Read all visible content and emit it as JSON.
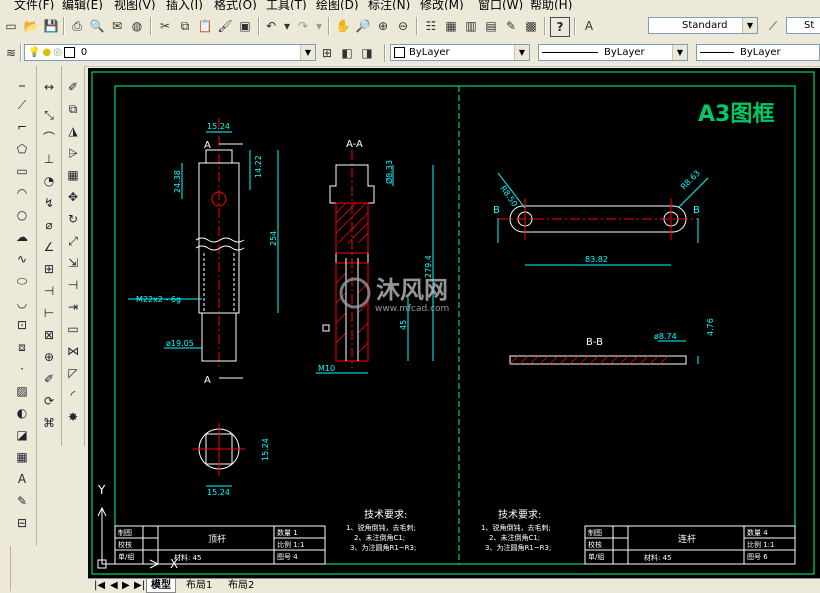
{
  "menu": [
    "文件(F)",
    "编辑(E)",
    "视图(V)",
    "插入(I)",
    "格式(O)",
    "工具(T)",
    "绘图(D)",
    "标注(N)",
    "修改(M)",
    "窗口(W)",
    "帮助(H)"
  ],
  "toolbar": {
    "text_style": "Standard",
    "dim_style": "St"
  },
  "layers": {
    "current_layer": "0",
    "color": "ByLayer",
    "linetype": "ByLayer",
    "lineweight": "ByLayer"
  },
  "drawing": {
    "frame_title": "A3图框",
    "section_aa": "A-A",
    "section_bb": "B-B",
    "label_a": "A",
    "label_b": "B",
    "dims": {
      "d1524_top": "15.24",
      "d1422": "14.22",
      "d2438": "24.38",
      "d254": "254",
      "thread": "M22x2 - 6g",
      "dia1905": "ø19.05",
      "d6833": "Ø8.33",
      "d2794": "279.4",
      "d45": "45",
      "m10": "M10",
      "r850": "R8.50",
      "r853": "R8.63",
      "d8382": "83.82",
      "dia874": "ø8.74",
      "d476": "4.76",
      "d1524_side": "15.24",
      "d1524_bottom": "15.24"
    },
    "tech_title": "技术要求:",
    "tech_lines": [
      "1、锐角倒钝，去毛刺;",
      "2、未注倒角C1;",
      "3、为注圆角R1~R3;"
    ],
    "title_blocks": [
      {
        "part_name": "顶杆",
        "qty": "数量 1",
        "scale": "比例 1:1",
        "drawing_no": "图号 4",
        "material": "材料: 45"
      },
      {
        "part_name": "连杆",
        "qty": "数量 4",
        "scale": "比例 1:1",
        "drawing_no": "图号 6",
        "material": "材料: 45"
      }
    ],
    "tb_rows": [
      "制图",
      "校核",
      "单/组"
    ],
    "watermark_text": "沐风网",
    "watermark_url": "www.mfcad.com",
    "ucs_x": "X",
    "ucs_y": "Y"
  },
  "layout_tabs": [
    "模型",
    "布局1",
    "布局2"
  ],
  "colors": {
    "canvas": "#000000",
    "frame": "#00ff7f",
    "dim": "#00ffff",
    "outline": "#ffffff",
    "center": "#ff0000",
    "hatch": "#ff0000",
    "title_text": "#00c864"
  }
}
